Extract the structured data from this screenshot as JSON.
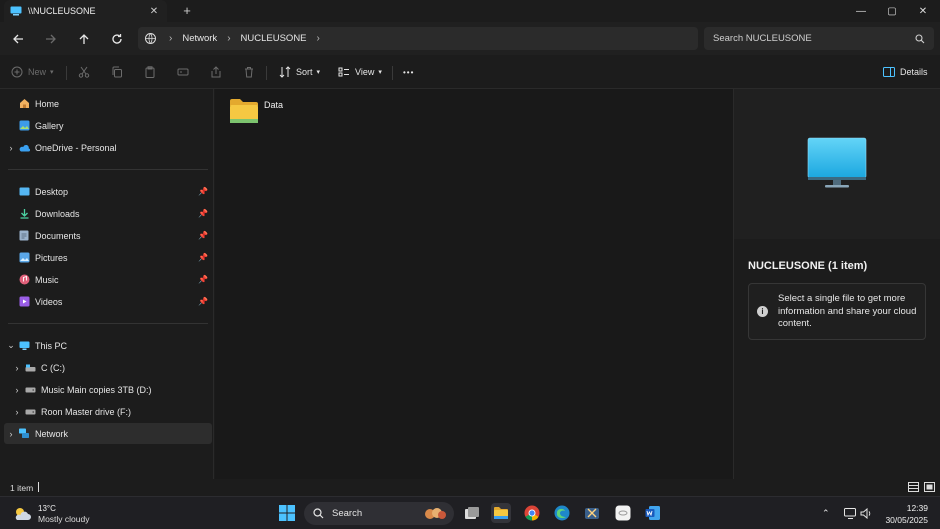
{
  "window": {
    "tab_title": "\\\\NUCLEUSONE",
    "tab_close": "✕",
    "new_tab": "+",
    "controls": {
      "minimize": "—",
      "maximize": "▢",
      "close": "✕"
    }
  },
  "address": {
    "breadcrumbs": [
      "Network",
      "NUCLEUSONE"
    ],
    "search_placeholder": "Search NUCLEUSONE"
  },
  "toolbar": {
    "new_label": "New",
    "sort_label": "Sort",
    "view_label": "View",
    "more_label": "•••",
    "details_label": "Details"
  },
  "sidebar": {
    "quick": [
      {
        "label": "Home",
        "icon": "home-icon"
      },
      {
        "label": "Gallery",
        "icon": "gallery-icon"
      },
      {
        "label": "OneDrive - Personal",
        "icon": "onedrive-icon"
      }
    ],
    "pinned": [
      {
        "label": "Desktop",
        "icon": "desktop-icon"
      },
      {
        "label": "Downloads",
        "icon": "downloads-icon"
      },
      {
        "label": "Documents",
        "icon": "documents-icon"
      },
      {
        "label": "Pictures",
        "icon": "pictures-icon"
      },
      {
        "label": "Music",
        "icon": "music-icon"
      },
      {
        "label": "Videos",
        "icon": "videos-icon"
      }
    ],
    "devices": [
      {
        "label": "This PC",
        "icon": "this-pc-icon"
      },
      {
        "label": "C (C:)",
        "icon": "drive-icon"
      },
      {
        "label": "Music Main copies 3TB (D:)",
        "icon": "drive-icon"
      },
      {
        "label": "Roon Master drive (F:)",
        "icon": "drive-icon"
      },
      {
        "label": "Network",
        "icon": "network-icon"
      }
    ]
  },
  "content": {
    "items": [
      {
        "name": "Data",
        "icon": "folder-icon"
      }
    ]
  },
  "details": {
    "title": "NUCLEUSONE (1 item)",
    "info_text": "Select a single file to get more information and share your cloud content."
  },
  "status": {
    "item_count": "1 item"
  },
  "taskbar": {
    "weather_temp": "13°C",
    "weather_condition": "Mostly cloudy",
    "search_label": "Search",
    "time": "12:39",
    "date": "30/05/2025"
  },
  "colors": {
    "accent": "#4cc2ff",
    "folder": "#f5c842",
    "background": "#1c1c1c"
  }
}
